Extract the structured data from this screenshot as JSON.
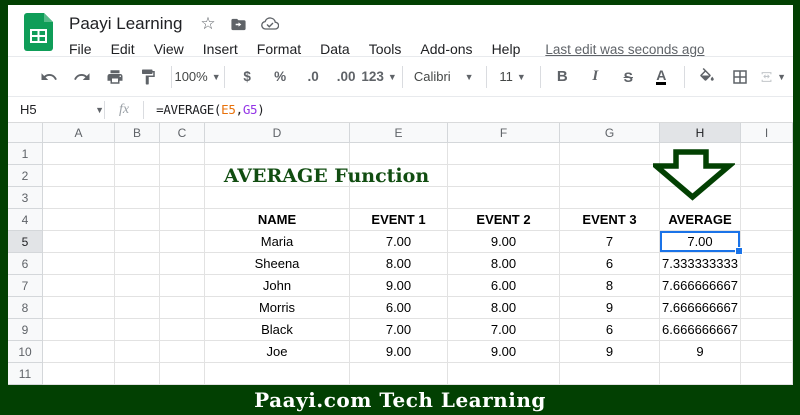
{
  "window": {
    "title": "Paayi Learning",
    "menu": [
      "File",
      "Edit",
      "View",
      "Insert",
      "Format",
      "Data",
      "Tools",
      "Add-ons",
      "Help"
    ],
    "last_edit": "Last edit was seconds ago"
  },
  "toolbar": {
    "zoom": "100%",
    "currency": "$",
    "percent": "%",
    "decrease_decimal": ".0",
    "increase_decimal": ".00",
    "more_formats": "123",
    "font": "Calibri",
    "font_size": "11",
    "bold": "B",
    "italic": "I",
    "strikethrough": "S",
    "text_color": "A"
  },
  "formula_bar": {
    "cell_ref": "H5",
    "fx_label": "fx",
    "parts": [
      {
        "text": "=AVERAGE(",
        "color": "#202124"
      },
      {
        "text": "E5",
        "color": "#e8710a"
      },
      {
        "text": ",",
        "color": "#202124"
      },
      {
        "text": "G5",
        "color": "#9334e6"
      },
      {
        "text": ")",
        "color": "#202124"
      }
    ]
  },
  "sheet": {
    "column_headers": [
      "A",
      "B",
      "C",
      "D",
      "E",
      "F",
      "G",
      "H",
      "I"
    ],
    "row_headers": [
      "1",
      "2",
      "3",
      "4",
      "5",
      "6",
      "7",
      "8",
      "9",
      "10",
      "11"
    ],
    "selected_column": "H",
    "selected_row": "5",
    "selected_cell_ref": "H5",
    "title_cell": {
      "row": "2",
      "text": "AVERAGE Function"
    },
    "table": {
      "header_row": "4",
      "columns": [
        "D",
        "E",
        "F",
        "G",
        "H"
      ],
      "headers": [
        "NAME",
        "EVENT 1",
        "EVENT 2",
        "EVENT 3",
        "AVERAGE"
      ],
      "rows": [
        [
          "Maria",
          "7.00",
          "9.00",
          "7",
          "7.00"
        ],
        [
          "Sheena",
          "8.00",
          "8.00",
          "6",
          "7.333333333"
        ],
        [
          "John",
          "9.00",
          "6.00",
          "8",
          "7.666666667"
        ],
        [
          "Morris",
          "6.00",
          "8.00",
          "9",
          "7.666666667"
        ],
        [
          "Black",
          "7.00",
          "7.00",
          "6",
          "6.666666667"
        ],
        [
          "Joe",
          "9.00",
          "9.00",
          "9",
          "9"
        ]
      ]
    }
  },
  "footer": {
    "text": "Paayi.com Tech Learning"
  },
  "colors": {
    "frame_green": "#024002",
    "sheets_green": "#0f9d58",
    "sheets_fold": "#57bb8a",
    "title_green": "#114d11",
    "selection_blue": "#1a73e8",
    "ref_orange": "#e8710a",
    "ref_purple": "#9334e6",
    "icon_grey": "#5f6368",
    "grid_line": "#e2e2e2"
  }
}
